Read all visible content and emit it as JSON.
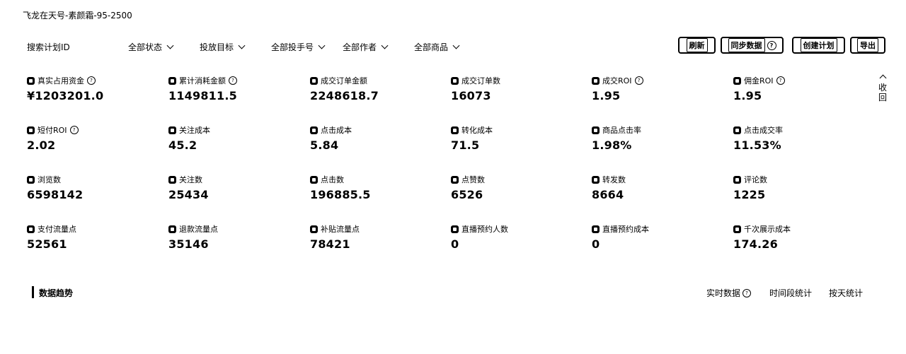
{
  "header": {
    "title": "飞龙在天号-素颜霜-95-2500"
  },
  "filters": {
    "search_placeholder": "搜索计划ID",
    "dropdowns": [
      "全部状态",
      "投放目标",
      "全部投手号",
      "全部作者",
      "全部商品"
    ]
  },
  "actions": {
    "refresh": "刷新",
    "sync": "同步数据",
    "create": "创建计划",
    "export": "导出"
  },
  "collapse_label": "收回",
  "metrics": [
    {
      "label": "真实占用资金",
      "value": "¥1203201.0",
      "help": true
    },
    {
      "label": "累计消耗金额",
      "value": "1149811.5",
      "help": true
    },
    {
      "label": "成交订单金额",
      "value": "2248618.7",
      "help": false
    },
    {
      "label": "成交订单数",
      "value": "16073",
      "help": false
    },
    {
      "label": "成交ROI",
      "value": "1.95",
      "help": true
    },
    {
      "label": "佣金ROI",
      "value": "1.95",
      "help": true
    },
    {
      "label": "短付ROI",
      "value": "2.02",
      "help": true
    },
    {
      "label": "关注成本",
      "value": "45.2",
      "help": false
    },
    {
      "label": "点击成本",
      "value": "5.84",
      "help": false
    },
    {
      "label": "转化成本",
      "value": "71.5",
      "help": false
    },
    {
      "label": "商品点击率",
      "value": "1.98%",
      "help": false
    },
    {
      "label": "点击成交率",
      "value": "11.53%",
      "help": false
    },
    {
      "label": "浏览数",
      "value": "6598142",
      "help": false
    },
    {
      "label": "关注数",
      "value": "25434",
      "help": false
    },
    {
      "label": "点击数",
      "value": "196885.5",
      "help": false
    },
    {
      "label": "点赞数",
      "value": "6526",
      "help": false
    },
    {
      "label": "转发数",
      "value": "8664",
      "help": false
    },
    {
      "label": "评论数",
      "value": "1225",
      "help": false
    },
    {
      "label": "支付流量点",
      "value": "52561",
      "help": false
    },
    {
      "label": "退款流量点",
      "value": "35146",
      "help": false
    },
    {
      "label": "补贴流量点",
      "value": "78421",
      "help": false
    },
    {
      "label": "直播预约人数",
      "value": "0",
      "help": false
    },
    {
      "label": "直播预约成本",
      "value": "0",
      "help": false
    },
    {
      "label": "千次展示成本",
      "value": "174.26",
      "help": false
    }
  ],
  "trend": {
    "title": "数据趋势",
    "tabs": [
      "实时数据",
      "时间段统计",
      "按天统计"
    ]
  }
}
